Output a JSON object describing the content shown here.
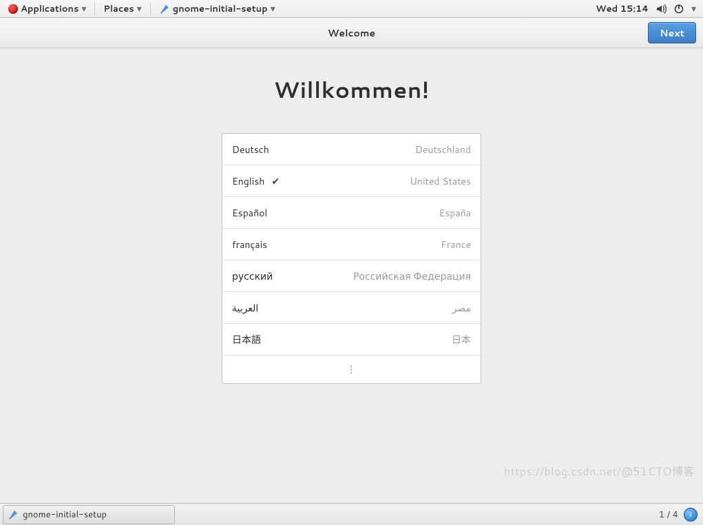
{
  "panel": {
    "applications": "Applications",
    "places": "Places",
    "app_name": "gnome-initial-setup",
    "clock": "Wed 15:14"
  },
  "header": {
    "title": "Welcome",
    "next": "Next"
  },
  "main": {
    "heading": "Willkommen!",
    "languages": [
      {
        "name": "Deutsch",
        "region": "Deutschland",
        "selected": false
      },
      {
        "name": "English",
        "region": "United States",
        "selected": true
      },
      {
        "name": "Español",
        "region": "España",
        "selected": false
      },
      {
        "name": "français",
        "region": "France",
        "selected": false
      },
      {
        "name": "русский",
        "region": "Российская Федерация",
        "selected": false
      },
      {
        "name": "العربية",
        "region": "مصر",
        "selected": false
      },
      {
        "name": "日本語",
        "region": "日本",
        "selected": false
      }
    ]
  },
  "taskbar": {
    "task": "gnome-initial-setup",
    "workspace": "1 / 4"
  },
  "watermark": "https://blog.csdn.net/@51CTO博客"
}
